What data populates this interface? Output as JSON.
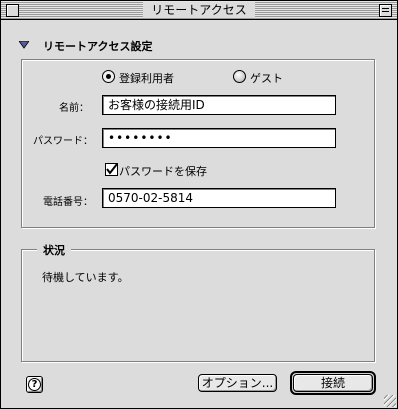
{
  "window": {
    "title": "リモートアクセス"
  },
  "section": {
    "title": "リモートアクセス設定"
  },
  "connection_type": {
    "options": [
      "登録利用者",
      "ゲスト"
    ],
    "selected": "登録利用者"
  },
  "form": {
    "name_label": "名前：",
    "name_value": "お客様の接続用ID",
    "password_label": "パスワード：",
    "password_value": "••••••••",
    "save_password_label": "パスワードを保存",
    "save_password_checked": true,
    "phone_label": "電話番号：",
    "phone_value": "0570-02-5814"
  },
  "status": {
    "title": "状況",
    "text": "待機しています。"
  },
  "buttons": {
    "options_label": "オプション...",
    "connect_label": "接続",
    "help_label": "?"
  }
}
